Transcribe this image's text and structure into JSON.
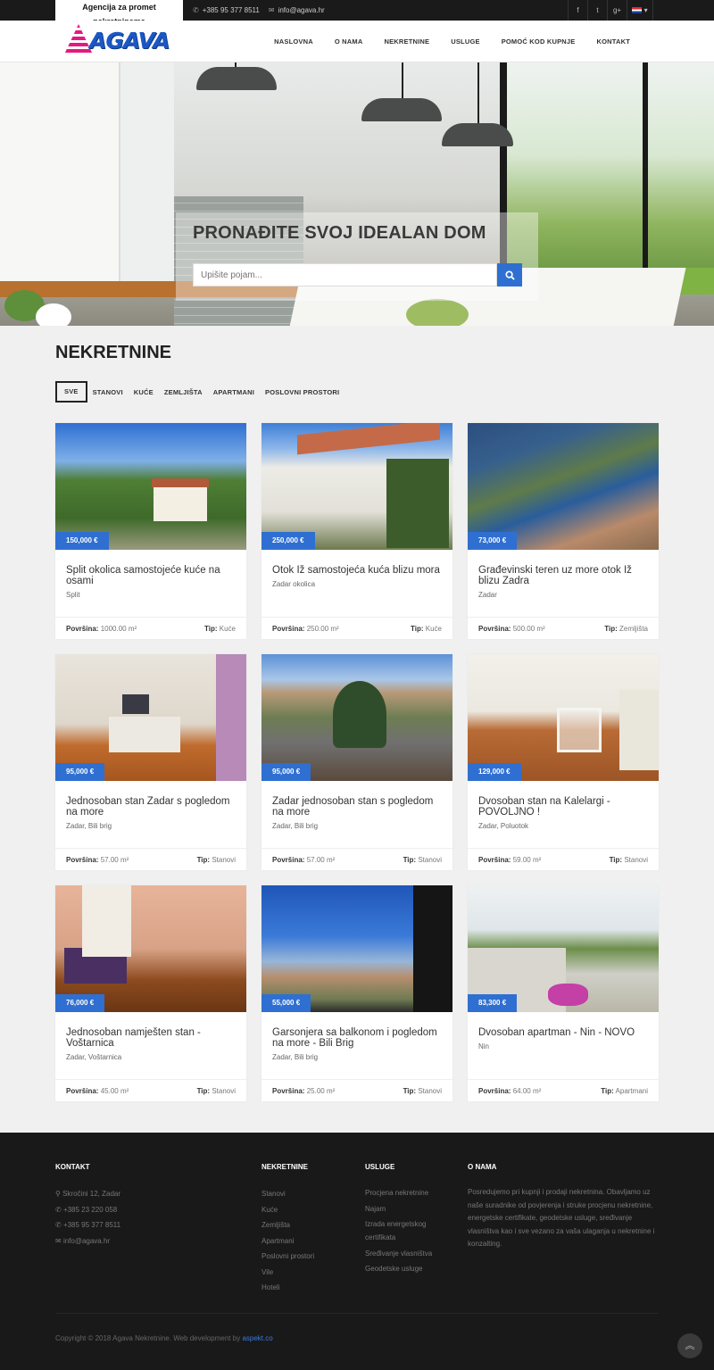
{
  "topbar": {
    "tagline": "Agencija za promet nekretninama",
    "phone": "+385 95 377 8511",
    "email": "info@agava.hr"
  },
  "brand": {
    "logo_text": "AGAVA"
  },
  "nav": [
    "NASLOVNA",
    "O NAMA",
    "NEKRETNINE",
    "USLUGE",
    "POMOĆ KOD KUPNJE",
    "KONTAKT"
  ],
  "hero": {
    "title": "PRONAĐITE SVOJ IDEALAN DOM",
    "search_placeholder": "Upišite pojam..."
  },
  "listings": {
    "title": "NEKRETNINE",
    "filters": [
      "SVE",
      "STANOVI",
      "KUĆE",
      "ZEMLJIŠTA",
      "APARTMANI",
      "POSLOVNI PROSTORI"
    ],
    "area_label": "Površina:",
    "type_label": "Tip:",
    "items": [
      {
        "price": "150,000 €",
        "title": "Split okolica samostojeće kuće na osami",
        "location": "Split",
        "area": "1000.00 m²",
        "type": "Kuće"
      },
      {
        "price": "250,000 €",
        "title": "Otok Iž samostojeća kuća blizu mora",
        "location": "Zadar okolica",
        "area": "250.00 m²",
        "type": "Kuće"
      },
      {
        "price": "73,000 €",
        "title": "Građevinski teren uz more otok Iž blizu Zadra",
        "location": "Zadar",
        "area": "500.00 m²",
        "type": "Zemljišta"
      },
      {
        "price": "95,000 €",
        "title": "Jednosoban stan Zadar s pogledom na more",
        "location": "Zadar, Bili brig",
        "area": "57.00 m²",
        "type": "Stanovi"
      },
      {
        "price": "95,000 €",
        "title": "Zadar jednosoban stan s pogledom na more",
        "location": "Zadar, Bili brig",
        "area": "57.00 m²",
        "type": "Stanovi"
      },
      {
        "price": "129,000 €",
        "title": "Dvosoban stan na Kalelargi - POVOLJNO !",
        "location": "Zadar, Poluotok",
        "area": "59.00 m²",
        "type": "Stanovi"
      },
      {
        "price": "76,000 €",
        "title": "Jednosoban namješten stan - Voštarnica",
        "location": "Zadar, Voštarnica",
        "area": "45.00 m²",
        "type": "Stanovi"
      },
      {
        "price": "55,000 €",
        "title": "Garsonjera sa balkonom i pogledom na more - Bili Brig",
        "location": "Zadar, Bili brig",
        "area": "25.00 m²",
        "type": "Stanovi"
      },
      {
        "price": "83,300 €",
        "title": "Dvosoban apartman - Nin - NOVO",
        "location": "Nin",
        "area": "64.00 m²",
        "type": "Apartmani"
      }
    ]
  },
  "footer": {
    "contact": {
      "heading": "KONTAKT",
      "address": "Skročini 12, Zadar",
      "phone1": "+385 23 220 058",
      "phone2": "+385 95 377 8511",
      "email": "info@agava.hr"
    },
    "properties": {
      "heading": "NEKRETNINE",
      "links": [
        "Stanovi",
        "Kuće",
        "Zemljišta",
        "Apartmani",
        "Poslovni prostori",
        "Vile",
        "Hoteli"
      ]
    },
    "services": {
      "heading": "USLUGE",
      "links": [
        "Procjena nekretnine",
        "Najam",
        "Izrada energetskog certifikata",
        "Sređivanje vlasništva",
        "Geodetske usluge"
      ]
    },
    "about": {
      "heading": "O NAMA",
      "text": "Posredujemo pri kupnji i prodaji nekretnina. Obavljamo uz naše suradnike od povjerenja i struke procjenu nekretnine, energetske certifikate, geodetske usluge, sređivanje vlasništva kao i sve vezano za vaša ulaganja u nekretnine i konzalting."
    },
    "copyright": "Copyright © 2018 Agava Nekretnine. Web development by",
    "dev_link": "aspekt.co"
  }
}
